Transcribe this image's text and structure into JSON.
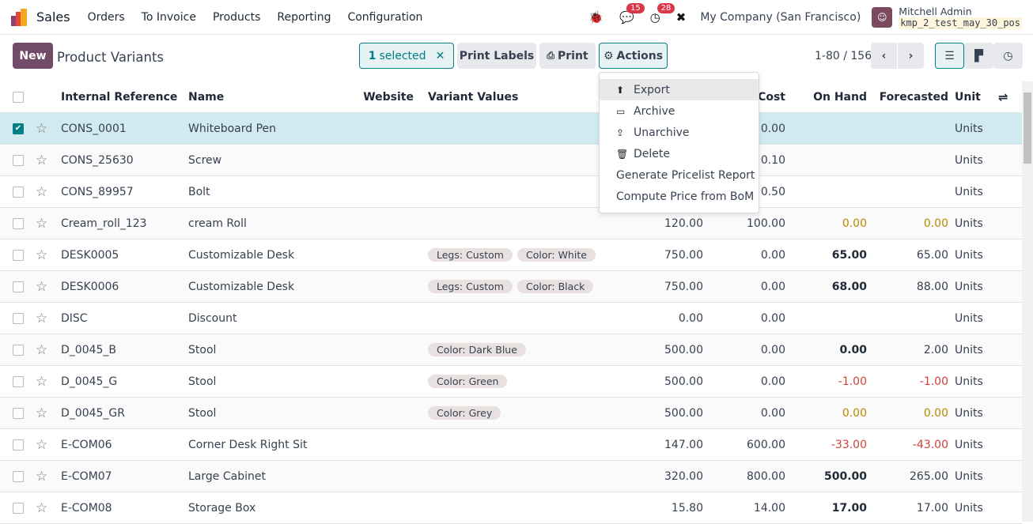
{
  "nav": {
    "app": "Sales",
    "menus": [
      "Orders",
      "To Invoice",
      "Products",
      "Reporting",
      "Configuration"
    ],
    "messages_count": "15",
    "activities_count": "28",
    "company": "My Company (San Francisco)",
    "user": "Mitchell Admin",
    "database": "kmp_2_test_may_30_pos"
  },
  "control": {
    "new_label": "New",
    "title": "Product Variants",
    "selected_count": "1",
    "selected_label": "selected",
    "print_labels": "Print Labels",
    "print": "Print",
    "actions": "Actions",
    "pager": "1-80 / 156"
  },
  "actions_menu": [
    {
      "label": "Export",
      "icon": "upload-icon"
    },
    {
      "label": "Archive",
      "icon": "inbox-icon"
    },
    {
      "label": "Unarchive",
      "icon": "unarchive-icon"
    },
    {
      "label": "Delete",
      "icon": "trash-icon"
    },
    {
      "label": "Generate Pricelist Report",
      "icon": ""
    },
    {
      "label": "Compute Price from BoM",
      "icon": ""
    }
  ],
  "columns": {
    "ref": "Internal Reference",
    "name": "Name",
    "website": "Website",
    "variants": "Variant Values",
    "price": "",
    "cost": "Cost",
    "on_hand": "On Hand",
    "forecasted": "Forecasted",
    "unit": "Unit"
  },
  "colors": {
    "brand": "#714b67",
    "accent": "#017e84",
    "warning": "#b98900",
    "danger": "#d23f3a"
  },
  "rows": [
    {
      "ref": "CONS_0001",
      "name": "Whiteboard Pen",
      "tags": [],
      "price": "",
      "cost": "0.00",
      "oh": "",
      "ohs": "",
      "fc": "",
      "fcs": "",
      "unit": "Units",
      "selected": true
    },
    {
      "ref": "CONS_25630",
      "name": "Screw",
      "tags": [],
      "price": "",
      "cost": "0.10",
      "oh": "",
      "ohs": "",
      "fc": "",
      "fcs": "",
      "unit": "Units"
    },
    {
      "ref": "CONS_89957",
      "name": "Bolt",
      "tags": [],
      "price": "",
      "cost": "0.50",
      "oh": "",
      "ohs": "",
      "fc": "",
      "fcs": "",
      "unit": "Units"
    },
    {
      "ref": "Cream_roll_123",
      "name": "cream Roll",
      "tags": [],
      "price": "120.00",
      "cost": "100.00",
      "oh": "0.00",
      "ohs": "warning",
      "fc": "0.00",
      "fcs": "warning",
      "unit": "Units"
    },
    {
      "ref": "DESK0005",
      "name": "Customizable Desk",
      "tags": [
        "Legs: Custom",
        "Color: White"
      ],
      "price": "750.00",
      "cost": "0.00",
      "oh": "65.00",
      "ohs": "bold",
      "fc": "65.00",
      "fcs": "",
      "unit": "Units"
    },
    {
      "ref": "DESK0006",
      "name": "Customizable Desk",
      "tags": [
        "Legs: Custom",
        "Color: Black"
      ],
      "price": "750.00",
      "cost": "0.00",
      "oh": "68.00",
      "ohs": "bold",
      "fc": "88.00",
      "fcs": "",
      "unit": "Units"
    },
    {
      "ref": "DISC",
      "name": "Discount",
      "tags": [],
      "price": "0.00",
      "cost": "0.00",
      "oh": "",
      "ohs": "",
      "fc": "",
      "fcs": "",
      "unit": "Units"
    },
    {
      "ref": "D_0045_B",
      "name": "Stool",
      "tags": [
        "Color: Dark Blue"
      ],
      "price": "500.00",
      "cost": "0.00",
      "oh": "0.00",
      "ohs": "bold",
      "fc": "2.00",
      "fcs": "",
      "unit": "Units"
    },
    {
      "ref": "D_0045_G",
      "name": "Stool",
      "tags": [
        "Color: Green"
      ],
      "price": "500.00",
      "cost": "0.00",
      "oh": "-1.00",
      "ohs": "danger",
      "fc": "-1.00",
      "fcs": "danger",
      "unit": "Units"
    },
    {
      "ref": "D_0045_GR",
      "name": "Stool",
      "tags": [
        "Color: Grey"
      ],
      "price": "500.00",
      "cost": "0.00",
      "oh": "0.00",
      "ohs": "warning",
      "fc": "0.00",
      "fcs": "warning",
      "unit": "Units"
    },
    {
      "ref": "E-COM06",
      "name": "Corner Desk Right Sit",
      "tags": [],
      "price": "147.00",
      "cost": "600.00",
      "oh": "-33.00",
      "ohs": "danger",
      "fc": "-43.00",
      "fcs": "danger",
      "unit": "Units"
    },
    {
      "ref": "E-COM07",
      "name": "Large Cabinet",
      "tags": [],
      "price": "320.00",
      "cost": "800.00",
      "oh": "500.00",
      "ohs": "bold",
      "fc": "265.00",
      "fcs": "",
      "unit": "Units"
    },
    {
      "ref": "E-COM08",
      "name": "Storage Box",
      "tags": [],
      "price": "15.80",
      "cost": "14.00",
      "oh": "17.00",
      "ohs": "bold",
      "fc": "17.00",
      "fcs": "",
      "unit": "Units"
    }
  ]
}
